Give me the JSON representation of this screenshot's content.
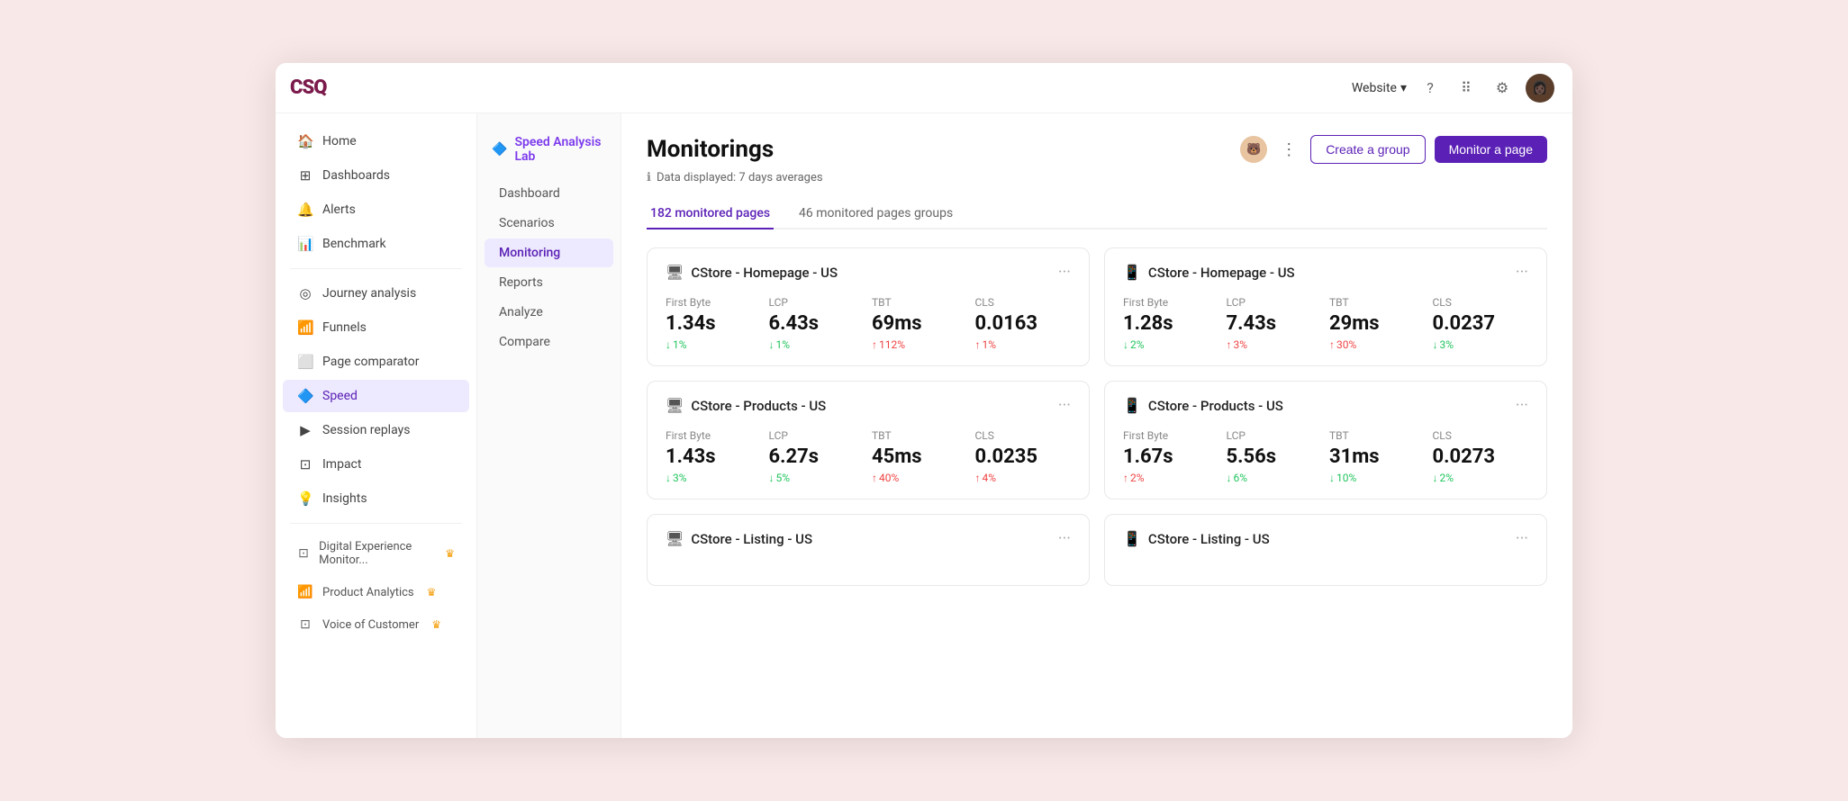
{
  "app": {
    "logo": "CSQ",
    "website_label": "Website",
    "topbar_icons": [
      "?",
      "⠿",
      "⚙"
    ],
    "avatar_emoji": "👩🏿"
  },
  "left_nav": {
    "items": [
      {
        "id": "home",
        "label": "Home",
        "icon": "🏠"
      },
      {
        "id": "dashboards",
        "label": "Dashboards",
        "icon": "⊞"
      },
      {
        "id": "alerts",
        "label": "Alerts",
        "icon": "🔔"
      },
      {
        "id": "benchmark",
        "label": "Benchmark",
        "icon": "📊"
      },
      {
        "id": "journey-analysis",
        "label": "Journey analysis",
        "icon": "◎"
      },
      {
        "id": "funnels",
        "label": "Funnels",
        "icon": "📶"
      },
      {
        "id": "page-comparator",
        "label": "Page comparator",
        "icon": "⬜"
      },
      {
        "id": "speed",
        "label": "Speed",
        "icon": "🔷",
        "active": true
      },
      {
        "id": "session-replays",
        "label": "Session replays",
        "icon": "▶"
      },
      {
        "id": "impact",
        "label": "Impact",
        "icon": "⊡"
      },
      {
        "id": "insights",
        "label": "Insights",
        "icon": "💡"
      }
    ],
    "sections": [
      {
        "id": "digital-exp",
        "label": "Digital Experience Monitor...",
        "icon": "⊡",
        "crown": true
      },
      {
        "id": "product-analytics",
        "label": "Product Analytics",
        "icon": "📶",
        "crown": true
      },
      {
        "id": "voice-of-customer",
        "label": "Voice of Customer",
        "icon": "⊡",
        "crown": true
      }
    ]
  },
  "sub_nav": {
    "header_label": "Speed Analysis Lab",
    "header_icon": "🔷",
    "items": [
      {
        "id": "dashboard",
        "label": "Dashboard"
      },
      {
        "id": "scenarios",
        "label": "Scenarios"
      },
      {
        "id": "monitoring",
        "label": "Monitoring",
        "active": true
      },
      {
        "id": "reports",
        "label": "Reports"
      },
      {
        "id": "analyze",
        "label": "Analyze"
      },
      {
        "id": "compare",
        "label": "Compare"
      }
    ]
  },
  "main": {
    "title": "Monitorings",
    "data_info": "Data displayed: 7 days averages",
    "tabs": [
      {
        "id": "monitored-pages",
        "label": "182 monitored pages",
        "active": true
      },
      {
        "id": "monitored-groups",
        "label": "46 monitored pages groups"
      }
    ],
    "create_group_label": "Create a group",
    "monitor_page_label": "Monitor a page",
    "cards": [
      {
        "id": "card-1",
        "title": "CStore - Homepage - US",
        "device": "desktop",
        "metrics": [
          {
            "label": "First Byte",
            "value": "1.34s",
            "change": "1%",
            "direction": "down"
          },
          {
            "label": "LCP",
            "value": "6.43s",
            "change": "1%",
            "direction": "down"
          },
          {
            "label": "TBT",
            "value": "69ms",
            "change": "112%",
            "direction": "up-bad"
          },
          {
            "label": "CLS",
            "value": "0.0163",
            "change": "1%",
            "direction": "up-bad"
          }
        ]
      },
      {
        "id": "card-2",
        "title": "CStore - Homepage - US",
        "device": "mobile",
        "metrics": [
          {
            "label": "First Byte",
            "value": "1.28s",
            "change": "2%",
            "direction": "down"
          },
          {
            "label": "LCP",
            "value": "7.43s",
            "change": "3%",
            "direction": "up-bad"
          },
          {
            "label": "TBT",
            "value": "29ms",
            "change": "30%",
            "direction": "up-bad"
          },
          {
            "label": "CLS",
            "value": "0.0237",
            "change": "3%",
            "direction": "down"
          }
        ]
      },
      {
        "id": "card-3",
        "title": "CStore - Products - US",
        "device": "desktop",
        "metrics": [
          {
            "label": "First Byte",
            "value": "1.43s",
            "change": "3%",
            "direction": "down"
          },
          {
            "label": "LCP",
            "value": "6.27s",
            "change": "5%",
            "direction": "down"
          },
          {
            "label": "TBT",
            "value": "45ms",
            "change": "40%",
            "direction": "up-bad"
          },
          {
            "label": "CLS",
            "value": "0.0235",
            "change": "4%",
            "direction": "up-bad"
          }
        ]
      },
      {
        "id": "card-4",
        "title": "CStore - Products - US",
        "device": "mobile",
        "metrics": [
          {
            "label": "First Byte",
            "value": "1.67s",
            "change": "2%",
            "direction": "up-bad"
          },
          {
            "label": "LCP",
            "value": "5.56s",
            "change": "6%",
            "direction": "down"
          },
          {
            "label": "TBT",
            "value": "31ms",
            "change": "10%",
            "direction": "down"
          },
          {
            "label": "CLS",
            "value": "0.0273",
            "change": "2%",
            "direction": "down"
          }
        ]
      },
      {
        "id": "card-5",
        "title": "CStore - Listing - US",
        "device": "desktop",
        "metrics": []
      },
      {
        "id": "card-6",
        "title": "CStore - Listing - US",
        "device": "mobile",
        "metrics": []
      }
    ]
  }
}
